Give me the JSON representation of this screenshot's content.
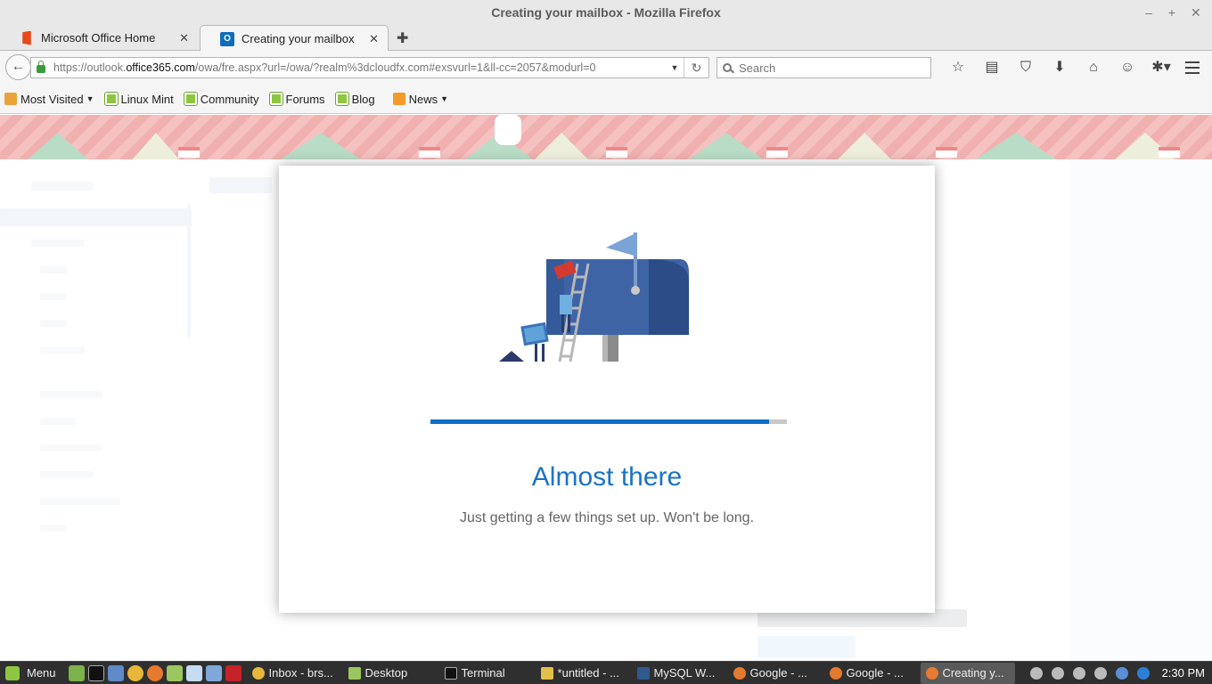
{
  "window": {
    "title": "Creating your mailbox - Mozilla Firefox",
    "controls": [
      "minimize",
      "maximize",
      "close"
    ]
  },
  "tabs": [
    {
      "label": "Microsoft Office Home",
      "icon": "office-icon",
      "active": false
    },
    {
      "label": "Creating your mailbox",
      "icon": "outlook-icon",
      "active": true
    }
  ],
  "nav": {
    "url_prefix": "https://outlook.",
    "url_domain": "office365.com",
    "url_suffix": "/owa/fre.aspx?url=/owa/?realm%3dcloudfx.com#exsvurl=1&ll-cc=2057&modurl=0",
    "search_placeholder": "Search"
  },
  "bookmarks": [
    {
      "label": "Most Visited",
      "icon": "folder-icon",
      "dropdown": true
    },
    {
      "label": "Linux Mint",
      "icon": "mint-icon"
    },
    {
      "label": "Community",
      "icon": "mint-icon"
    },
    {
      "label": "Forums",
      "icon": "mint-icon"
    },
    {
      "label": "Blog",
      "icon": "mint-icon"
    },
    {
      "label": "News",
      "icon": "rss-icon",
      "dropdown": true
    }
  ],
  "dialog": {
    "heading": "Almost there",
    "subtext": "Just getting a few things set up. Won't be long.",
    "progress_fraction": 0.95
  },
  "taskbar": {
    "menu_label": "Menu",
    "tasks": [
      {
        "label": "Inbox - brs...",
        "icon": "chrome-icon"
      },
      {
        "label": "Desktop",
        "icon": "folder-icon"
      },
      {
        "label": "Terminal",
        "icon": "terminal-icon"
      },
      {
        "label": "*untitled - ...",
        "icon": "editor-icon"
      },
      {
        "label": "MySQL W...",
        "icon": "mysql-icon"
      },
      {
        "label": "Google - ...",
        "icon": "firefox-icon"
      },
      {
        "label": "Google - ...",
        "icon": "firefox-icon"
      },
      {
        "label": "Creating y...",
        "icon": "firefox-icon",
        "active": true
      }
    ],
    "clock": "2:30 PM"
  },
  "colors": {
    "accent": "#0f6fc6",
    "heading": "#1a73c4",
    "taskbar": "#2f2f2f"
  }
}
